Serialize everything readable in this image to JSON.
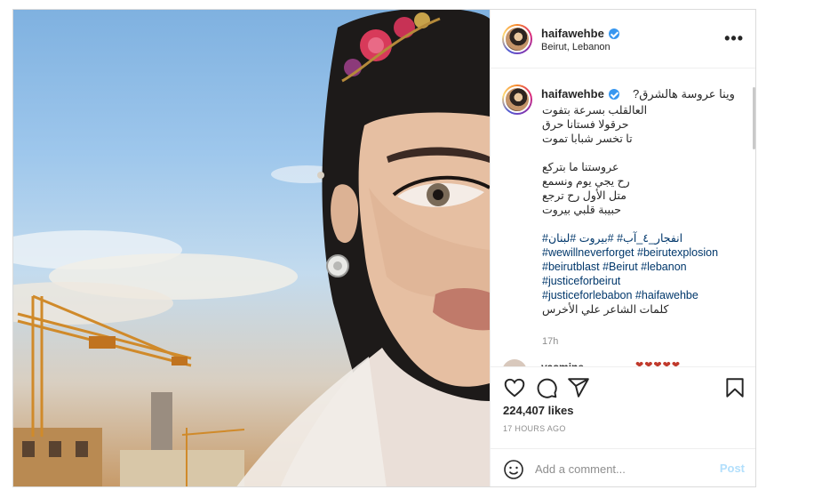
{
  "header": {
    "username": "haifawehbe",
    "location": "Beirut, Lebanon",
    "more_label": "•••"
  },
  "caption": {
    "username": "haifawehbe",
    "first_line": "وينا عروسة هالشرق?",
    "lines_a": [
      "العالقلب بسرعة بتفوت",
      "حرقولا فستانا حرق",
      "تا تخسر شبابا تموت"
    ],
    "lines_b": [
      "عروستنا ما بتركع",
      "رح يجي يوم ونسمع",
      "متل الأول رح ترجع",
      "حبيبة قلبي بيروت"
    ],
    "hashtags": [
      "انفجار_٤_آب# #بيروت #لبنان#",
      "#wewillneverforget #beirutexplosion",
      "#beirutblast #Beirut #lebanon",
      "#justiceforbeirut",
      "#justiceforlebabon #haifawehbe"
    ],
    "closing": "كلمات الشاعر علي الأخرس",
    "time": "17h"
  },
  "next_comment": {
    "username": "yasmine",
    "emojis": "❤❤❤❤❤"
  },
  "stats": {
    "likes": "224,407 likes",
    "posted_ago": "17 HOURS AGO"
  },
  "add_comment": {
    "placeholder": "Add a comment...",
    "post_label": "Post"
  },
  "icons": {
    "like": "heart-icon",
    "comment": "comment-icon",
    "share": "share-icon",
    "save": "bookmark-icon",
    "emoji": "smile-icon",
    "verified": "verified-badge-icon"
  },
  "colors": {
    "hashtag": "#00376b",
    "verified": "#3897f0",
    "post_button_disabled": "#b2dffc",
    "muted": "#8e8e8e"
  }
}
